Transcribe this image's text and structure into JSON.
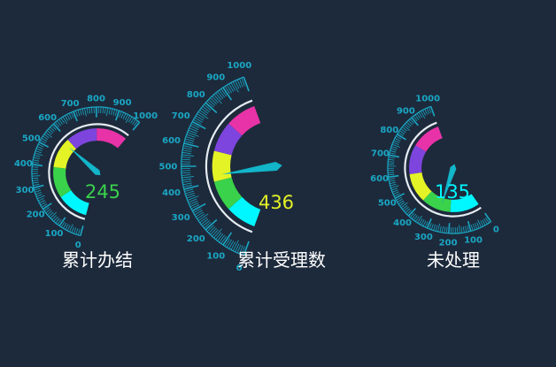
{
  "colors": {
    "background": "#1d2a3c",
    "ticks": "#1aa7c4",
    "inner_ring": "#e6ecf2",
    "pointer": "#12b5c9",
    "band_1": "#00f7ff",
    "band_2": "#3ad24a",
    "band_3": "#e3f326",
    "band_4": "#7d45dd",
    "band_5": "#e833a8"
  },
  "chart_data": [
    {
      "type": "gauge",
      "title": "累计办结",
      "value": 245,
      "value_text": "245",
      "value_color": "#3ad24a",
      "min": 0,
      "max": 1000,
      "ticks": [
        "0",
        "100",
        "200",
        "300",
        "400",
        "500",
        "600",
        "700",
        "800",
        "900",
        "1000"
      ],
      "start_angle": 255,
      "end_angle": 50,
      "bands": [
        {
          "from": 0,
          "to": 20,
          "color": "#00f7ff"
        },
        {
          "from": 20,
          "to": 40,
          "color": "#3ad24a"
        },
        {
          "from": 40,
          "to": 60,
          "color": "#e3f326"
        },
        {
          "from": 60,
          "to": 80,
          "color": "#7d45dd"
        },
        {
          "from": 80,
          "to": 100,
          "color": "#e833a8"
        }
      ],
      "pointer_value": 57
    },
    {
      "type": "gauge",
      "title": "累计受理数",
      "value": 436,
      "value_text": "436",
      "value_color": "#e3f326",
      "min": 0,
      "max": 1000,
      "ticks": [
        "0",
        "100",
        "200",
        "300",
        "400",
        "500",
        "600",
        "700",
        "800",
        "900",
        "1000"
      ],
      "start_angle": 250,
      "end_angle": 110,
      "bands": [
        {
          "from": 0,
          "to": 20,
          "color": "#00f7ff"
        },
        {
          "from": 20,
          "to": 40,
          "color": "#3ad24a"
        },
        {
          "from": 40,
          "to": 60,
          "color": "#e3f326"
        },
        {
          "from": 60,
          "to": 80,
          "color": "#7d45dd"
        },
        {
          "from": 80,
          "to": 100,
          "color": "#e833a8"
        }
      ],
      "pointer_value": 44
    },
    {
      "type": "gauge",
      "title": "未处理",
      "value": 135,
      "value_text": "135",
      "value_color": "#00f7ff",
      "min": 0,
      "max": 1000,
      "ticks": [
        "0",
        "100",
        "200",
        "300",
        "400",
        "500",
        "600",
        "700",
        "800",
        "900",
        "1000"
      ],
      "start_angle": 305,
      "end_angle": 110,
      "bands": [
        {
          "from": 0,
          "to": 20,
          "color": "#00f7ff"
        },
        {
          "from": 20,
          "to": 40,
          "color": "#3ad24a"
        },
        {
          "from": 40,
          "to": 60,
          "color": "#e3f326"
        },
        {
          "from": 60,
          "to": 80,
          "color": "#7d45dd"
        },
        {
          "from": 80,
          "to": 100,
          "color": "#e833a8"
        }
      ],
      "pointer_value": 27
    }
  ]
}
